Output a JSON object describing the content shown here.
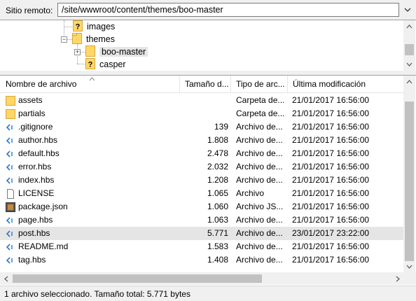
{
  "remote": {
    "label": "Sitio remoto:",
    "path": "/site/wwwroot/content/themes/boo-master"
  },
  "tree": {
    "nodes": [
      {
        "name": "images",
        "icon": "unknown-folder-icon"
      },
      {
        "name": "themes",
        "icon": "folder-open-icon"
      },
      {
        "name": "boo-master",
        "icon": "folder-icon"
      },
      {
        "name": "casper",
        "icon": "unknown-folder-icon"
      }
    ]
  },
  "list": {
    "columns": [
      "Nombre de archivo",
      "Tamaño d...",
      "Tipo de arc...",
      "Última modificación"
    ],
    "rows": [
      {
        "name": "assets",
        "size": "",
        "type": "Carpeta de...",
        "modified": "21/01/2017 16:56:00",
        "icon": "folder-icon"
      },
      {
        "name": "partials",
        "size": "",
        "type": "Carpeta de...",
        "modified": "21/01/2017 16:56:00",
        "icon": "folder-icon"
      },
      {
        "name": ".gitignore",
        "size": "139",
        "type": "Archivo de...",
        "modified": "21/01/2017 16:56:00",
        "icon": "code-file-icon"
      },
      {
        "name": "author.hbs",
        "size": "1.808",
        "type": "Archivo de...",
        "modified": "21/01/2017 16:56:00",
        "icon": "code-file-icon"
      },
      {
        "name": "default.hbs",
        "size": "2.478",
        "type": "Archivo de...",
        "modified": "21/01/2017 16:56:00",
        "icon": "code-file-icon"
      },
      {
        "name": "error.hbs",
        "size": "2.032",
        "type": "Archivo de...",
        "modified": "21/01/2017 16:56:00",
        "icon": "code-file-icon"
      },
      {
        "name": "index.hbs",
        "size": "1.208",
        "type": "Archivo de...",
        "modified": "21/01/2017 16:56:00",
        "icon": "code-file-icon"
      },
      {
        "name": "LICENSE",
        "size": "1.065",
        "type": "Archivo",
        "modified": "21/01/2017 16:56:00",
        "icon": "blank-file-icon"
      },
      {
        "name": "package.json",
        "size": "1.060",
        "type": "Archivo JS...",
        "modified": "21/01/2017 16:56:00",
        "icon": "json-file-icon"
      },
      {
        "name": "page.hbs",
        "size": "1.063",
        "type": "Archivo de...",
        "modified": "21/01/2017 16:56:00",
        "icon": "code-file-icon"
      },
      {
        "name": "post.hbs",
        "size": "5.771",
        "type": "Archivo de...",
        "modified": "23/01/2017 23:22:00",
        "icon": "code-file-icon",
        "selected": true
      },
      {
        "name": "README.md",
        "size": "1.583",
        "type": "Archivo de...",
        "modified": "21/01/2017 16:56:00",
        "icon": "code-file-icon"
      },
      {
        "name": "tag.hbs",
        "size": "1.408",
        "type": "Archivo de...",
        "modified": "21/01/2017 16:56:00",
        "icon": "code-file-icon"
      }
    ]
  },
  "status": {
    "text": "1 archivo seleccionado. Tamaño total: 5.771 bytes"
  },
  "colors": {
    "folder": "#ffd766",
    "folder_edge": "#d9a63b",
    "selection": "#e5e5e5",
    "code_icon": "#2b79c9"
  }
}
